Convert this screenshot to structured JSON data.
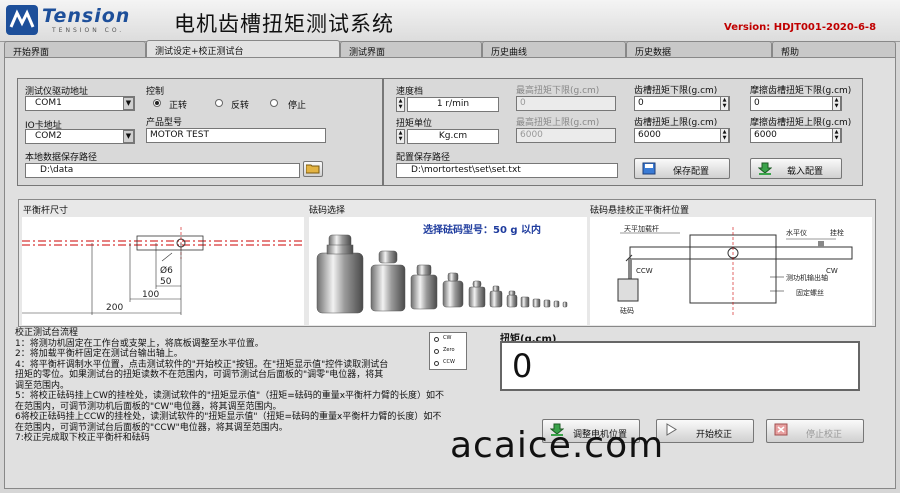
{
  "app": {
    "brand": "Tension",
    "brand_sub": "TENSION CO.",
    "title": "电机齿槽扭矩测试系统",
    "version": "Version: HDJT001-2020-6-8"
  },
  "tabs": [
    {
      "label": "开始界面"
    },
    {
      "label": "测试设定+校正测试台"
    },
    {
      "label": "测试界面"
    },
    {
      "label": "历史曲线"
    },
    {
      "label": "历史数据"
    },
    {
      "label": "帮助"
    }
  ],
  "settings": {
    "driver_addr_label": "测试仪驱动地址",
    "driver_addr_value": "COM1",
    "control_label": "控制",
    "radio_forward": "正转",
    "radio_reverse": "反转",
    "radio_stop": "停止",
    "io_label": "IO卡地址",
    "io_value": "COM2",
    "model_label": "产品型号",
    "model_value": "MOTOR TEST",
    "save_path_label": "本地数据保存路径",
    "save_path_value": "D:\\data"
  },
  "config": {
    "speed_label": "速度档",
    "speed_value": "1 r/min",
    "unit_label": "扭矩单位",
    "unit_value": "Kg.cm",
    "max_low_label": "最高扭矩下限(g.cm)",
    "max_low_value": "0",
    "max_high_label": "最高扭矩上限(g.cm)",
    "max_high_value": "6000",
    "cog_low_label": "齿槽扭矩下限(g.cm)",
    "cog_low_value": "0",
    "cog_high_label": "齿槽扭矩上限(g.cm)",
    "cog_high_value": "6000",
    "fric_low_label": "摩擦齿槽扭矩下限(g.cm)",
    "fric_low_value": "0",
    "fric_high_label": "摩擦齿槽扭矩上限(g.cm)",
    "fric_high_value": "6000",
    "path_label": "配置保存路径",
    "path_value": "D:\\mortortest\\set\\set.txt",
    "save_btn": "保存配置",
    "load_btn": "载入配置"
  },
  "panels": {
    "lever_title": "平衡杆尺寸",
    "mass_title": "砝码选择",
    "hang_title": "砝码悬挂校正平衡杆位置",
    "mass_caption": "选择砝码型号：50 g 以内",
    "dim_phi6": "Ø6",
    "dim_50": "50",
    "dim_100": "100",
    "dim_200": "200",
    "d_hanger": "天平加载杆",
    "d_level": "水平仪",
    "d_pin": "挂栓",
    "d_ccw": "CCW",
    "d_cw": "CW",
    "d_shaft": "测功机输出轴",
    "d_screw": "固定螺丝",
    "d_weight": "砝码"
  },
  "instructions": {
    "title": "校正测试台流程",
    "lines": [
      "1：将测功机固定在工作台或支架上，将底板调整至水平位置。",
      "2：将加载平衡杆固定在测试台输出轴上。",
      "4：将平衡杆调制水平位置，点击测试软件的\"开始校正\"按钮。在\"扭矩显示值\"控件读取测试台",
      "扭矩的零位。如果测试台的扭矩读数不在范围内，可调节测试台后面板的\"调零\"电位器，将其",
      "调至范围内。",
      "5：将校正砝码挂上CW的挂栓处，读测试软件的\"扭矩显示值\"（扭矩=砝码的重量x平衡杆力臂的长度）如不",
      "在范围内，可调节测功机后面板的\"CW\"电位器，将其调至范围内。",
      "6将校正砝码挂上CCW的挂栓处，读测试软件的\"扭矩显示值\"（扭矩=砝码的重量x平衡杆力臂的长度）如不",
      "在范围内，可调节测试台后面板的\"CCW\"电位器，将其调至范围内。",
      "7:校正完成取下校正平衡杆和砝码"
    ]
  },
  "pot_legend": {
    "cw": "CW",
    "zero": "Zero",
    "ccw": "CCW"
  },
  "torque": {
    "label": "扭矩(g.cm)",
    "value": "0"
  },
  "actions": {
    "adjust": "调整电机位置",
    "start": "开始校正",
    "stop": "停止校正"
  },
  "watermark": "acaice.com"
}
